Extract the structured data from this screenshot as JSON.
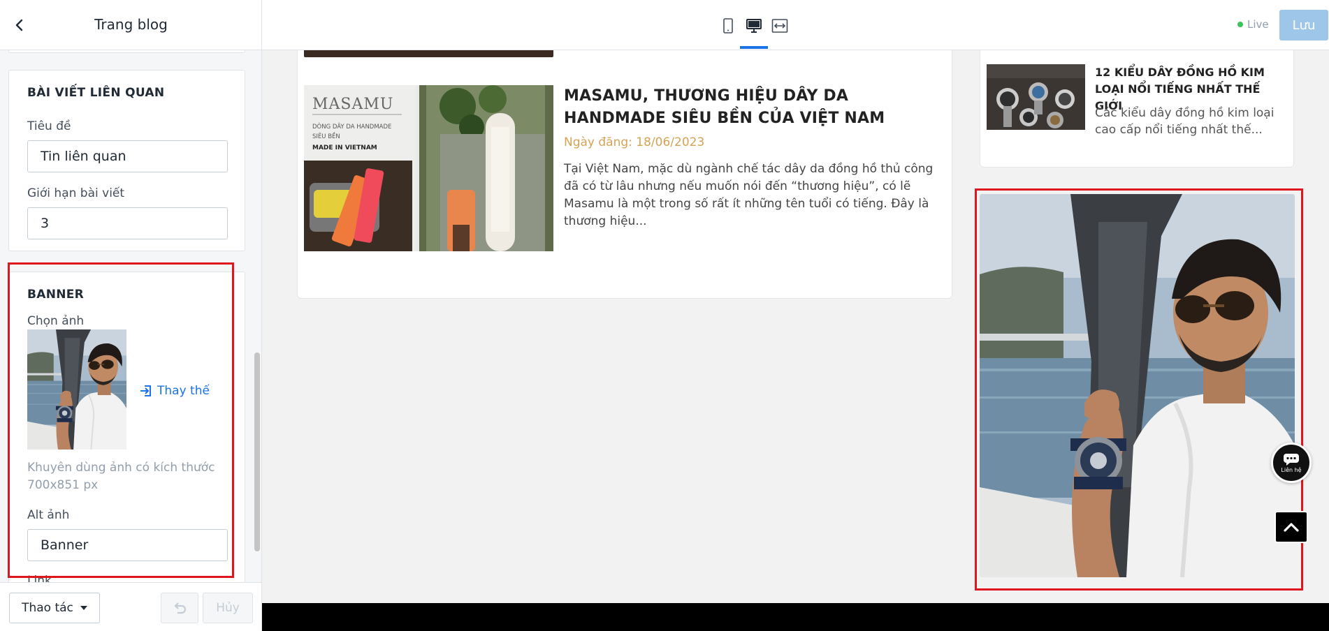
{
  "sidebar": {
    "title": "Trang blog",
    "related_section": {
      "title": "BÀI VIẾT LIÊN QUAN",
      "heading_label": "Tiêu đề",
      "heading_value": "Tin liên quan",
      "limit_label": "Giới hạn bài viết",
      "limit_value": "3"
    },
    "banner_section": {
      "title": "BANNER",
      "choose_image_label": "Chọn ảnh",
      "replace_label": "Thay thế",
      "hint": "Khuyên dùng ảnh có kích thước 700x851 px",
      "alt_label": "Alt ảnh",
      "alt_value": "Banner",
      "link_label": "Link"
    },
    "footer": {
      "actions_label": "Thao tác",
      "cancel_label": "Hủy"
    }
  },
  "toolbar": {
    "views": [
      "mobile-icon",
      "desktop-icon",
      "fullwidth-icon"
    ],
    "active_view": "desktop",
    "live_label": "Live",
    "save_label": "Lưu"
  },
  "content": {
    "post": {
      "title": "MASAMU, THƯƠNG HIỆU DÂY DA HANDMADE SIÊU BỀN CỦA VIỆT NAM",
      "date": "Ngày đăng: 18/06/2023",
      "excerpt": "Tại Việt Nam, mặc dù ngành chế tác dây da đồng hồ thủ công đã có từ lâu nhưng nếu muốn nói đến “thương hiệu”, có lẽ Masamu là một trong số rất ít những tên tuổi có tiếng. Đây là thương hiệu...",
      "thumb_brand": "MASAMU",
      "thumb_line1": "DÒNG DÂY DA HANDMADE",
      "thumb_line2": "SIÊU BỀN",
      "thumb_line3": "MADE IN VIETNAM"
    },
    "related": {
      "title": "12 KIỂU DÂY ĐỒNG HỒ KIM LOẠI NỔI TIẾNG NHẤT THẾ GIỚI",
      "excerpt": "Các kiểu dây đồng hồ kim loại cao cấp nổi tiếng nhất thế..."
    },
    "contact_label": "Liên hệ"
  },
  "colors": {
    "highlight": "#e0161e",
    "accent": "#1a73e8",
    "date": "#d4a355",
    "save_button": "#9ec6e8",
    "live_dot": "#3ac45a"
  }
}
